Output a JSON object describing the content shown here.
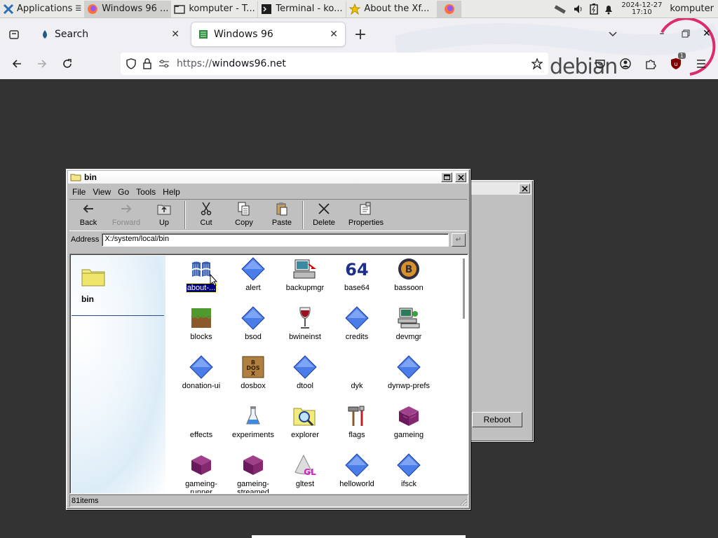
{
  "xfce_panel": {
    "apps_label": "Applications",
    "tasks": [
      {
        "label": "Windows 96 ...",
        "icon": "firefox-icon"
      },
      {
        "label": "komputer - T...",
        "icon": "folder-icon"
      },
      {
        "label": "Terminal - ko...",
        "icon": "terminal-icon"
      },
      {
        "label": "About the Xf...",
        "icon": "star-icon"
      }
    ],
    "clock": {
      "date": "2024-12-27",
      "time": "17:10"
    },
    "user": "komputer"
  },
  "browser": {
    "tabs": [
      {
        "label": "Search"
      },
      {
        "label": "Windows 96"
      }
    ],
    "url": {
      "protocol": "https://",
      "host": "windows96.net"
    },
    "debian_text": "debian",
    "extension_badge": "1"
  },
  "back_window": {
    "reboot_label": "Reboot"
  },
  "bin_window": {
    "title": "bin",
    "menu": [
      "File",
      "View",
      "Go",
      "Tools",
      "Help"
    ],
    "toolbar": [
      {
        "label": "Back",
        "icon": "back-arrow-icon",
        "enabled": true
      },
      {
        "label": "Forward",
        "icon": "forward-arrow-icon",
        "enabled": false
      },
      {
        "label": "Up",
        "icon": "up-folder-icon",
        "enabled": true
      },
      {
        "label": "Cut",
        "icon": "scissors-icon",
        "enabled": true
      },
      {
        "label": "Copy",
        "icon": "copy-icon",
        "enabled": true
      },
      {
        "label": "Paste",
        "icon": "paste-icon",
        "enabled": true
      },
      {
        "label": "Delete",
        "icon": "delete-x-icon",
        "enabled": true
      },
      {
        "label": "Properties",
        "icon": "properties-icon",
        "enabled": true
      }
    ],
    "address_label": "Address",
    "address_value": "X:/system/local/bin",
    "left_pane_title": "bin",
    "items": [
      {
        "name": "about-...",
        "icon": "windows-flag-icon",
        "selected": true
      },
      {
        "name": "alert",
        "icon": "blue-diamond-icon"
      },
      {
        "name": "backupmgr",
        "icon": "backup-computer-icon"
      },
      {
        "name": "base64",
        "icon": "base64-icon"
      },
      {
        "name": "bassoon",
        "icon": "bassoon-logo-icon"
      },
      {
        "name": "blocks",
        "icon": "grass-block-icon"
      },
      {
        "name": "bsod",
        "icon": "blue-diamond-icon"
      },
      {
        "name": "bwineinst",
        "icon": "wine-glass-icon"
      },
      {
        "name": "credits",
        "icon": "blue-diamond-icon"
      },
      {
        "name": "devmgr",
        "icon": "device-manager-icon"
      },
      {
        "name": "donation-ui",
        "icon": "blue-diamond-icon"
      },
      {
        "name": "dosbox",
        "icon": "dosbox-icon"
      },
      {
        "name": "dtool",
        "icon": "blue-diamond-icon"
      },
      {
        "name": "dyk",
        "icon": "blank-icon"
      },
      {
        "name": "dynwp-prefs",
        "icon": "blue-diamond-icon"
      },
      {
        "name": "effects",
        "icon": "blank-icon"
      },
      {
        "name": "experiments",
        "icon": "flask-icon"
      },
      {
        "name": "explorer",
        "icon": "magnifier-folder-icon"
      },
      {
        "name": "flags",
        "icon": "tools-icon"
      },
      {
        "name": "gameing",
        "icon": "purple-cube-icon"
      },
      {
        "name": "gameing-runner",
        "icon": "purple-cube-icon"
      },
      {
        "name": "gameing-streamed",
        "icon": "purple-cube-icon"
      },
      {
        "name": "gltest",
        "icon": "gl-cone-icon"
      },
      {
        "name": "helloworld",
        "icon": "blue-diamond-icon"
      },
      {
        "name": "ifsck",
        "icon": "blue-diamond-icon"
      }
    ],
    "status": "81items"
  }
}
